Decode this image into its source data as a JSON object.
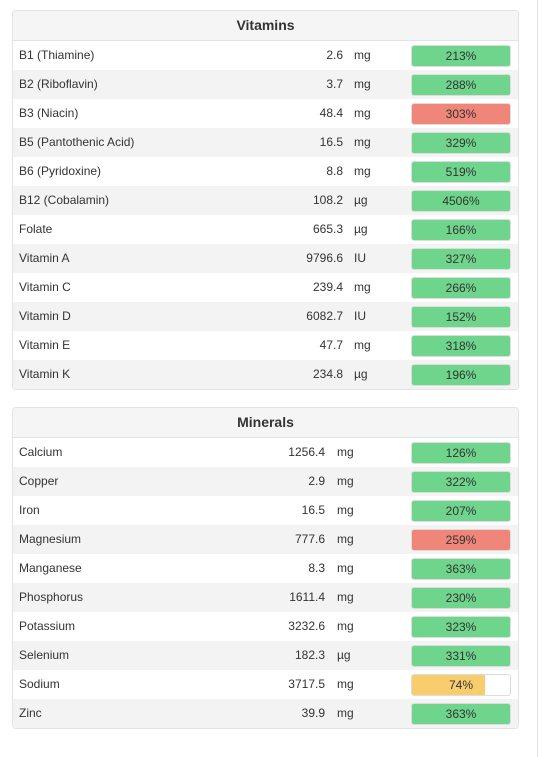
{
  "vitamins": {
    "title": "Vitamins",
    "rows": [
      {
        "name": "B1 (Thiamine)",
        "amount": "2.6",
        "unit": "mg",
        "percent": "213%",
        "fill": 1.0,
        "color": "#6fd58c"
      },
      {
        "name": "B2 (Riboflavin)",
        "amount": "3.7",
        "unit": "mg",
        "percent": "288%",
        "fill": 1.0,
        "color": "#6fd58c"
      },
      {
        "name": "B3 (Niacin)",
        "amount": "48.4",
        "unit": "mg",
        "percent": "303%",
        "fill": 1.0,
        "color": "#f0857a"
      },
      {
        "name": "B5 (Pantothenic Acid)",
        "amount": "16.5",
        "unit": "mg",
        "percent": "329%",
        "fill": 1.0,
        "color": "#6fd58c"
      },
      {
        "name": "B6 (Pyridoxine)",
        "amount": "8.8",
        "unit": "mg",
        "percent": "519%",
        "fill": 1.0,
        "color": "#6fd58c"
      },
      {
        "name": "B12 (Cobalamin)",
        "amount": "108.2",
        "unit": "µg",
        "percent": "4506%",
        "fill": 1.0,
        "color": "#6fd58c"
      },
      {
        "name": "Folate",
        "amount": "665.3",
        "unit": "µg",
        "percent": "166%",
        "fill": 1.0,
        "color": "#6fd58c"
      },
      {
        "name": "Vitamin A",
        "amount": "9796.6",
        "unit": "IU",
        "percent": "327%",
        "fill": 1.0,
        "color": "#6fd58c"
      },
      {
        "name": "Vitamin C",
        "amount": "239.4",
        "unit": "mg",
        "percent": "266%",
        "fill": 1.0,
        "color": "#6fd58c"
      },
      {
        "name": "Vitamin D",
        "amount": "6082.7",
        "unit": "IU",
        "percent": "152%",
        "fill": 1.0,
        "color": "#6fd58c"
      },
      {
        "name": "Vitamin E",
        "amount": "47.7",
        "unit": "mg",
        "percent": "318%",
        "fill": 1.0,
        "color": "#6fd58c"
      },
      {
        "name": "Vitamin K",
        "amount": "234.8",
        "unit": "µg",
        "percent": "196%",
        "fill": 1.0,
        "color": "#6fd58c"
      }
    ]
  },
  "minerals": {
    "title": "Minerals",
    "rows": [
      {
        "name": "Calcium",
        "amount": "1256.4",
        "unit": "mg",
        "percent": "126%",
        "fill": 1.0,
        "color": "#6fd58c"
      },
      {
        "name": "Copper",
        "amount": "2.9",
        "unit": "mg",
        "percent": "322%",
        "fill": 1.0,
        "color": "#6fd58c"
      },
      {
        "name": "Iron",
        "amount": "16.5",
        "unit": "mg",
        "percent": "207%",
        "fill": 1.0,
        "color": "#6fd58c"
      },
      {
        "name": "Magnesium",
        "amount": "777.6",
        "unit": "mg",
        "percent": "259%",
        "fill": 1.0,
        "color": "#f0857a"
      },
      {
        "name": "Manganese",
        "amount": "8.3",
        "unit": "mg",
        "percent": "363%",
        "fill": 1.0,
        "color": "#6fd58c"
      },
      {
        "name": "Phosphorus",
        "amount": "1611.4",
        "unit": "mg",
        "percent": "230%",
        "fill": 1.0,
        "color": "#6fd58c"
      },
      {
        "name": "Potassium",
        "amount": "3232.6",
        "unit": "mg",
        "percent": "323%",
        "fill": 1.0,
        "color": "#6fd58c"
      },
      {
        "name": "Selenium",
        "amount": "182.3",
        "unit": "µg",
        "percent": "331%",
        "fill": 1.0,
        "color": "#6fd58c"
      },
      {
        "name": "Sodium",
        "amount": "3717.5",
        "unit": "mg",
        "percent": "74%",
        "fill": 0.74,
        "color": "#f7cd6e"
      },
      {
        "name": "Zinc",
        "amount": "39.9",
        "unit": "mg",
        "percent": "363%",
        "fill": 1.0,
        "color": "#6fd58c"
      }
    ]
  }
}
